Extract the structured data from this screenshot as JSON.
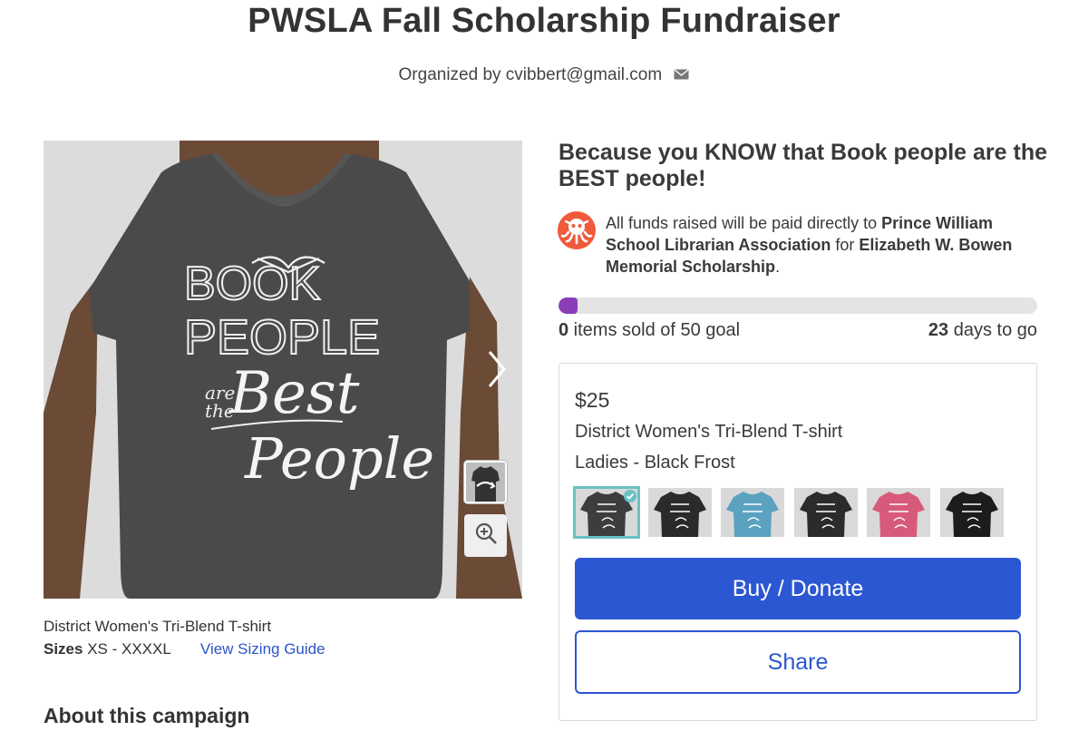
{
  "campaign": {
    "title": "PWSLA Fall Scholarship Fundraiser",
    "organizer_prefix": "Organized by",
    "organizer_email": "cvibbert@gmail.com",
    "organizer_line": "Organized by cvibbert@gmail.com"
  },
  "product": {
    "name": "District Women's Tri-Blend T-shirt",
    "sizes_label": "Sizes",
    "sizes_range": "XS - XXXXL",
    "sizing_guide_link": "View Sizing Guide",
    "shirt_text": {
      "line1": "BOOK",
      "line2": "PEOPLE",
      "line3a": "are",
      "line3b": "the",
      "line4": "Best",
      "line5": "People"
    }
  },
  "about": {
    "heading": "About this campaign"
  },
  "details": {
    "headline": "Because you KNOW that Book people are the BEST people!",
    "funds_prefix": "All funds raised will be paid directly to ",
    "beneficiary": "Prince William School Librarian Association",
    "funds_mid": " for ",
    "fund_name": "Elizabeth W. Bowen Memorial Scholarship",
    "funds_suffix": "."
  },
  "progress": {
    "sold_count": "0",
    "sold_text": " items sold of 50 goal",
    "days_count": "23",
    "days_text": " days to go",
    "fill_color": "#8a3fb8"
  },
  "purchase": {
    "price": "$25",
    "style": "District Women's Tri-Blend T-shirt",
    "variant": "Ladies - Black Frost",
    "swatches": [
      {
        "name": "Black Frost",
        "color": "#3d3d3d",
        "text": "#ffffff"
      },
      {
        "name": "Black",
        "color": "#2a2a2a",
        "text": "#ffffff"
      },
      {
        "name": "Blue",
        "color": "#5aa2c0",
        "text": "#ffffff"
      },
      {
        "name": "Black V",
        "color": "#2b2b2b",
        "text": "#ffffff"
      },
      {
        "name": "Pink",
        "color": "#d85a7a",
        "text": "#ffffff"
      },
      {
        "name": "Black Long Sleeve",
        "color": "#1c1c1c",
        "text": "#ffffff"
      }
    ],
    "buy_label": "Buy / Donate",
    "share_label": "Share"
  },
  "colors": {
    "primary": "#2c57d2",
    "accent_teal": "#69c1c6",
    "brand_orange": "#f05a3c"
  }
}
